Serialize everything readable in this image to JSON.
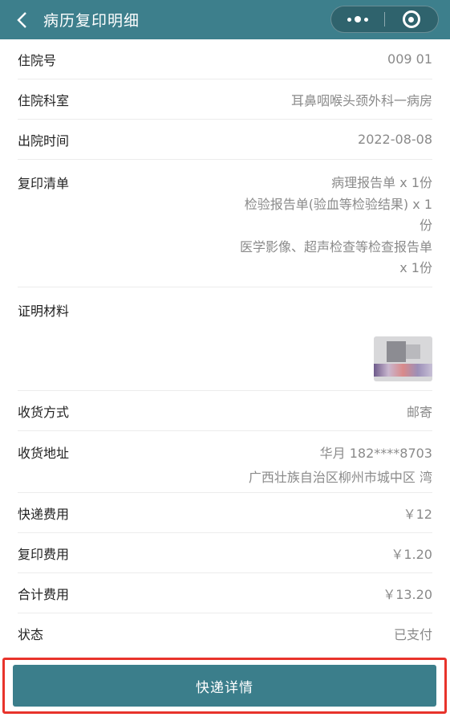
{
  "navbar": {
    "title": "病历复印明细",
    "icons": {
      "back": "chevron-left-icon",
      "more": "more-dots-icon",
      "close": "mini-program-close-icon"
    },
    "color": "#3d7f8c"
  },
  "details": {
    "admission_no": {
      "label": "住院号",
      "value": "009 01"
    },
    "department": {
      "label": "住院科室",
      "value": "耳鼻咽喉头颈外科一病房"
    },
    "discharge_time": {
      "label": "出院时间",
      "value": "2022-08-08"
    },
    "copy_list": {
      "label": "复印清单",
      "items": [
        "病理报告单 x 1份",
        "检验报告单(验血等检验结果) x 1份",
        "医学影像、超声检查等检查报告单 x 1份"
      ]
    },
    "proof": {
      "label": "证明材料"
    },
    "delivery_method": {
      "label": "收货方式",
      "value": "邮寄"
    },
    "address": {
      "label": "收货地址",
      "contact": "华月 182****8703",
      "line": "广西壮族自治区柳州市城中区 湾"
    },
    "express_fee": {
      "label": "快递费用",
      "value": "￥12"
    },
    "copy_fee": {
      "label": "复印费用",
      "value": "￥1.20"
    },
    "total_fee": {
      "label": "合计费用",
      "value": "￥13.20"
    },
    "status": {
      "label": "状态",
      "value": "已支付"
    }
  },
  "footer": {
    "button_label": "快递详情",
    "button_color": "#3b7e8b",
    "highlight_color": "#e8332b"
  }
}
